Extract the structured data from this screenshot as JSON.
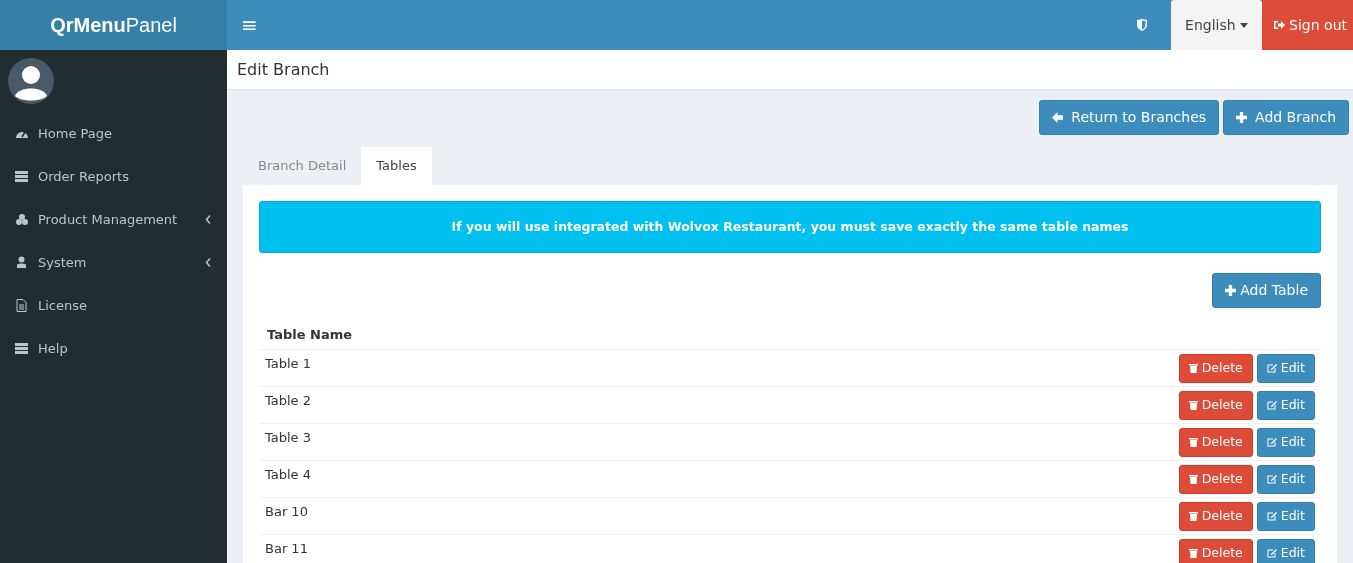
{
  "header": {
    "logo_bold": "QrMenu",
    "logo_light": "Panel",
    "menu_toggle": "≡",
    "language": "English",
    "sign_out": "Sign out"
  },
  "sidebar": {
    "items": [
      {
        "label": "Home Page",
        "kind": "link"
      },
      {
        "label": "Order Reports",
        "kind": "link"
      },
      {
        "label": "Product Management",
        "kind": "submenu",
        "expanded": false
      },
      {
        "label": "System",
        "kind": "submenu",
        "expanded": false
      },
      {
        "label": "License",
        "kind": "link"
      },
      {
        "label": "Help",
        "kind": "link"
      }
    ]
  },
  "page_title": "Edit Branch",
  "actions": [
    "Return to Branches",
    "Add Branch"
  ],
  "tabs": [
    {
      "label": "Branch Detail",
      "selected": false
    },
    {
      "label": "Tables",
      "selected": true
    }
  ],
  "alert": "If you will use integrated with Wolvox Restaurant, you must save exactly the same table names",
  "add_table": "Add Table",
  "table": {
    "columns": [
      "Table Name"
    ],
    "rows": [
      {
        "name": "Table 1",
        "delete": "Delete",
        "edit": "Edit"
      },
      {
        "name": "Table 2",
        "delete": "Delete",
        "edit": "Edit"
      },
      {
        "name": "Table 3",
        "delete": "Delete",
        "edit": "Edit"
      },
      {
        "name": "Table 4",
        "delete": "Delete",
        "edit": "Edit"
      },
      {
        "name": "Bar 10",
        "delete": "Delete",
        "edit": "Edit"
      },
      {
        "name": "Bar 11",
        "delete": "Delete",
        "edit": "Edit"
      }
    ]
  }
}
